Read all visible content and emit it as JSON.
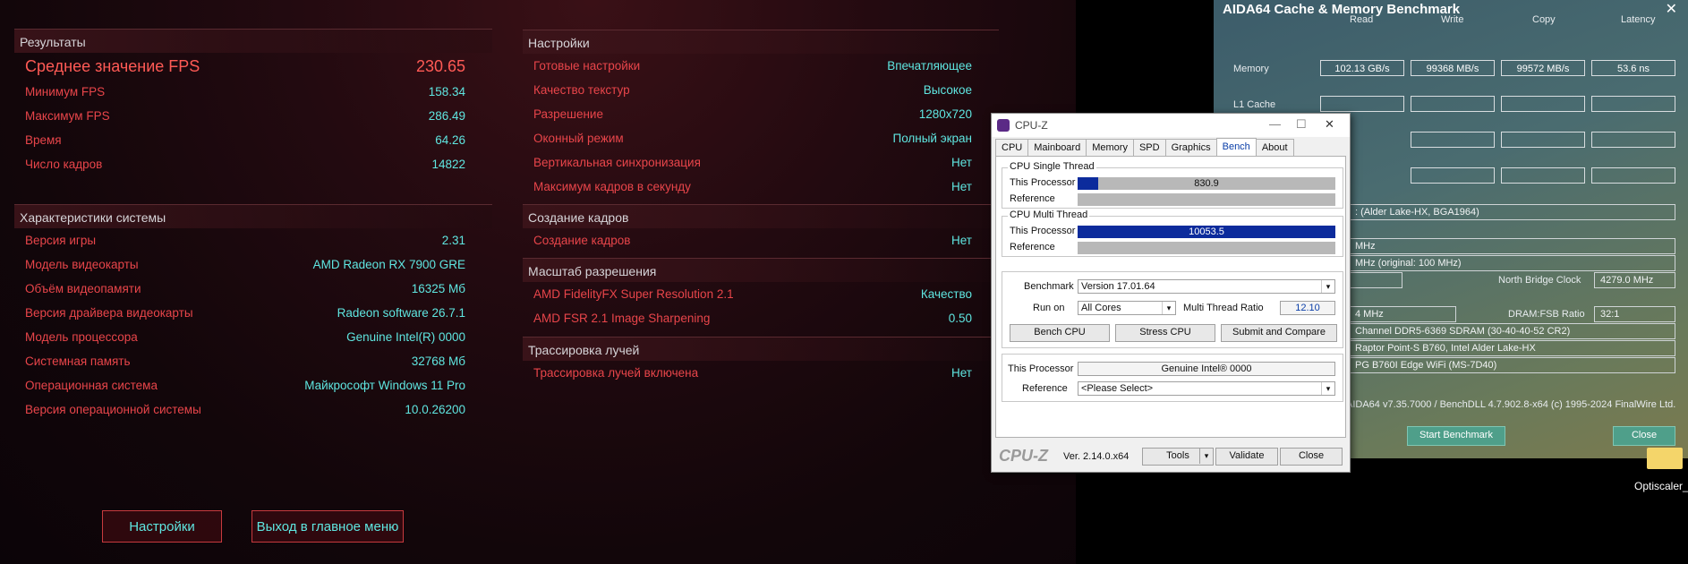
{
  "game": {
    "results": {
      "title": "Результаты",
      "rows": [
        {
          "label": "Среднее значение FPS",
          "value": "230.65"
        },
        {
          "label": "Минимум FPS",
          "value": "158.34"
        },
        {
          "label": "Максимум FPS",
          "value": "286.49"
        },
        {
          "label": "Время",
          "value": "64.26"
        },
        {
          "label": "Число кадров",
          "value": "14822"
        }
      ]
    },
    "system": {
      "title": "Характеристики системы",
      "rows": [
        {
          "label": "Версия игры",
          "value": "2.31"
        },
        {
          "label": "Модель видеокарты",
          "value": "AMD Radeon RX 7900 GRE"
        },
        {
          "label": "Объём видеопамяти",
          "value": "16325 Мб"
        },
        {
          "label": "Версия драйвера видеокарты",
          "value": "Radeon software 26.7.1"
        },
        {
          "label": "Модель процессора",
          "value": "Genuine Intel(R) 0000"
        },
        {
          "label": "Системная память",
          "value": "32768 Мб"
        },
        {
          "label": "Операционная система",
          "value": "Майкрософт Windows 11 Pro"
        },
        {
          "label": "Версия операционной системы",
          "value": "10.0.26200"
        }
      ]
    },
    "settings": {
      "title": "Настройки",
      "rows": [
        {
          "label": "Готовые настройки",
          "value": "Впечатляющее"
        },
        {
          "label": "Качество текстур",
          "value": "Высокое"
        },
        {
          "label": "Разрешение",
          "value": "1280x720"
        },
        {
          "label": "Оконный режим",
          "value": "Полный экран"
        },
        {
          "label": "Вертикальная синхронизация",
          "value": "Нет"
        },
        {
          "label": "Максимум кадров в секунду",
          "value": "Нет"
        }
      ]
    },
    "frames": {
      "title": "Создание кадров",
      "rows": [
        {
          "label": "Создание кадров",
          "value": "Нет"
        }
      ]
    },
    "scaling": {
      "title": "Масштаб разрешения",
      "rows": [
        {
          "label": "AMD FidelityFX Super Resolution 2.1",
          "value": "Качество"
        },
        {
          "label": "AMD FSR 2.1 Image Sharpening",
          "value": "0.50"
        }
      ]
    },
    "raytracing": {
      "title": "Трассировка лучей",
      "rows": [
        {
          "label": "Трассировка лучей включена",
          "value": "Нет"
        }
      ]
    },
    "buttons": {
      "settings": "Настройки",
      "exit": "Выход в главное меню"
    }
  },
  "aida": {
    "title": "AIDA64 Cache & Memory Benchmark",
    "close_glyph": "✕",
    "columns": [
      "Read",
      "Write",
      "Copy",
      "Latency"
    ],
    "memory": {
      "label": "Memory",
      "values": [
        "102.13 GB/s",
        "99368 MB/s",
        "99572 MB/s",
        "53.6 ns"
      ]
    },
    "l1": {
      "label": "L1 Cache"
    },
    "info": {
      "cpu_partial": ": (Alder Lake-HX, BGA1964)",
      "mhz1": "MHz",
      "mhz2": "MHz  (original: 100 MHz)",
      "nb_label": "North Bridge Clock",
      "nb_value": "4279.0 MHz",
      "mem_freq": "4 MHz",
      "dram_label": "DRAM:FSB Ratio",
      "dram_value": "32:1",
      "memtype": "Channel DDR5-6369 SDRAM  (30-40-40-52 CR2)",
      "chipset": "Raptor Point-S B760, Intel Alder Lake-HX",
      "board": "PG B760I Edge WiFi (MS-7D40)",
      "version": "AIDA64 v7.35.7000 / BenchDLL 4.7.902.8-x64  (c) 1995-2024 FinalWire Ltd."
    },
    "start_button": "Start Benchmark",
    "close_button": "Close"
  },
  "cpuz": {
    "title": "CPU-Z",
    "tabs": [
      "CPU",
      "Mainboard",
      "Memory",
      "SPD",
      "Graphics",
      "Bench",
      "About"
    ],
    "active_tab": "Bench",
    "single": {
      "title": "CPU Single Thread",
      "this_label": "This Processor",
      "value": "830.9",
      "fill": 0.08,
      "ref_label": "Reference"
    },
    "multi": {
      "title": "CPU Multi Thread",
      "this_label": "This Processor",
      "value": "10053.5",
      "fill": 1.0,
      "ref_label": "Reference"
    },
    "benchmark_label": "Benchmark",
    "benchmark_value": "Version 17.01.64",
    "runon_label": "Run on",
    "runon_value": "All Cores",
    "ratio_label": "Multi Thread Ratio",
    "ratio_value": "12.10",
    "buttons": {
      "bench": "Bench CPU",
      "stress": "Stress CPU",
      "submit": "Submit and Compare"
    },
    "this_proc_label": "This Processor",
    "this_proc_value": "Genuine Intel® 0000",
    "reference_label": "Reference",
    "reference_value": "<Please Select>",
    "brand": "CPU-Z",
    "version": "Ver. 2.14.0.x64",
    "tools": "Tools",
    "validate": "Validate",
    "close": "Close",
    "win_min": "—",
    "win_max": "☐",
    "win_close": "✕",
    "dropdown_arrow": "▾"
  },
  "desktop": {
    "icon_label": "Optiscaler_..."
  }
}
